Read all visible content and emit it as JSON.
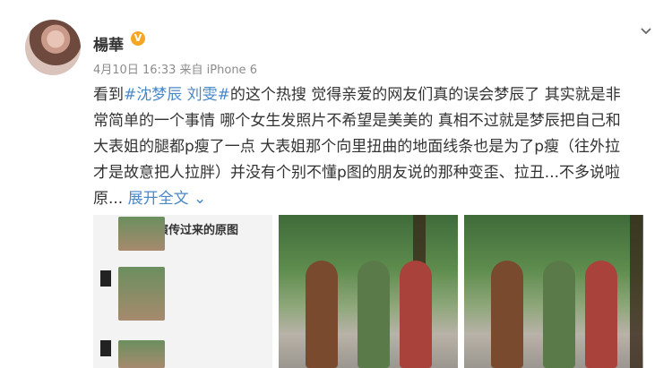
{
  "post": {
    "username": "楊華",
    "verified_badge": "V",
    "meta": "4月10日 16:33 来自 iPhone 6",
    "lines": [
      {
        "pre": "看到",
        "hashtag": "#沈梦辰 刘雯#",
        "post": "的这个热搜 觉得亲爱的网友们真的误会梦辰了 其实就是非"
      },
      {
        "text": "常简单的一个事情 哪个女生发照片不希望是美美的 真相不过就是梦辰把自己和"
      },
      {
        "text": "大表姐的腿都p瘦了一点 大表姐那个向里扭曲的地面线条也是为了p瘦（往外拉"
      },
      {
        "text": "才是故意把人拉胖）并没有个别不懂p图的朋友说的那种变歪、拉丑...不多说啦"
      },
      {
        "pre": "原...",
        "more": "展开全文",
        "chev": "⌄"
      }
    ],
    "photos": {
      "first_caption": "导演传过来的原图"
    }
  },
  "icons": {
    "avatar": "user-avatar",
    "more_menu": "chevron-down-icon"
  },
  "colors": {
    "link": "#4a88c8",
    "badge": "#f5a623"
  }
}
